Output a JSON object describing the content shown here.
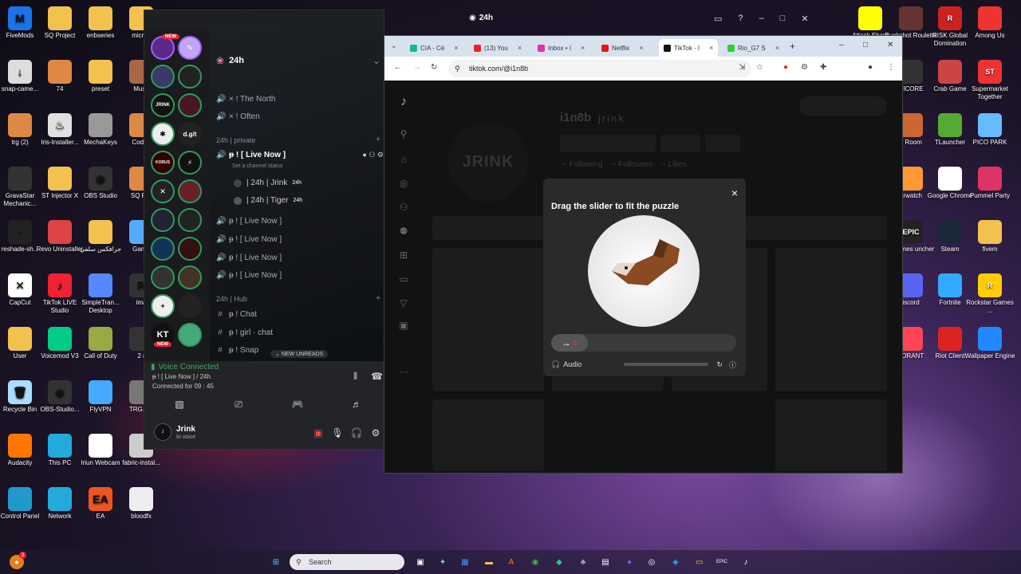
{
  "desktop_left": [
    {
      "label": "FiveMods",
      "glyph": "M",
      "color": "#1a73e8"
    },
    {
      "label": "SQ Project",
      "glyph": "",
      "color": "#f2c14e"
    },
    {
      "label": "enbseries",
      "glyph": "",
      "color": "#f2c14e"
    },
    {
      "label": "micros",
      "glyph": "",
      "color": "#f2c14e"
    },
    {
      "label": "snap-came...",
      "glyph": "↓",
      "color": "#ddd"
    },
    {
      "label": "74",
      "glyph": "",
      "color": "#d84"
    },
    {
      "label": "preset",
      "glyph": "",
      "color": "#f2c14e"
    },
    {
      "label": "Muse",
      "glyph": "",
      "color": "#a64"
    },
    {
      "label": "trg (2)",
      "glyph": "",
      "color": "#d84"
    },
    {
      "label": "Iris-Installer...",
      "glyph": "♨",
      "color": "#e0e0e0"
    },
    {
      "label": "MechaKeys",
      "glyph": "",
      "color": "#999"
    },
    {
      "label": "Codec",
      "glyph": "",
      "color": "#d84"
    },
    {
      "label": "GravaStar Mechanic...",
      "glyph": "",
      "color": "#333"
    },
    {
      "label": "ST Injector X",
      "glyph": "",
      "color": "#f2c14e"
    },
    {
      "label": "OBS Studio",
      "glyph": "◉",
      "color": "#333"
    },
    {
      "label": "SQ Pro",
      "glyph": "",
      "color": "#d84"
    },
    {
      "label": "reshade-sh...",
      "glyph": "·",
      "color": "#222"
    },
    {
      "label": "Revo Uninstaller",
      "glyph": "",
      "color": "#d44"
    },
    {
      "label": "جرافكس سلفي",
      "glyph": "",
      "color": "#f2c14e"
    },
    {
      "label": "Game",
      "glyph": "",
      "color": "#5af"
    },
    {
      "label": "CapCut",
      "glyph": "✕",
      "color": "#fff"
    },
    {
      "label": "TikTok LIVE Studio",
      "glyph": "♪",
      "color": "#e23"
    },
    {
      "label": "SimpleTran... Desktop",
      "glyph": "",
      "color": "#58f"
    },
    {
      "label": "ima",
      "glyph": "R",
      "color": "#333"
    },
    {
      "label": "User",
      "glyph": "",
      "color": "#f2c14e"
    },
    {
      "label": "Voicemod V3",
      "glyph": "",
      "color": "#0c8"
    },
    {
      "label": "Call of Duty",
      "glyph": "",
      "color": "#9a4"
    },
    {
      "label": "2 (",
      "glyph": "",
      "color": "#333"
    },
    {
      "label": "Recycle Bin",
      "glyph": "🗑",
      "color": "#adf"
    },
    {
      "label": "OBS-Studio...",
      "glyph": "◉",
      "color": "#333"
    },
    {
      "label": "FlyVPN",
      "glyph": "",
      "color": "#4af"
    },
    {
      "label": "TRG.SC",
      "glyph": "",
      "color": "#777"
    },
    {
      "label": "Audacity",
      "glyph": "",
      "color": "#f70"
    },
    {
      "label": "This PC",
      "glyph": "",
      "color": "#2ad"
    },
    {
      "label": "Iriun Webcam",
      "glyph": "",
      "color": "#fff"
    },
    {
      "label": "fabric-instal...",
      "glyph": "",
      "color": "#ccc"
    },
    {
      "label": "Control Panel",
      "glyph": "",
      "color": "#29c"
    },
    {
      "label": "Network",
      "glyph": "",
      "color": "#2ad"
    },
    {
      "label": "EA",
      "glyph": "EA",
      "color": "#e52"
    },
    {
      "label": "bloodfx",
      "glyph": "",
      "color": "#eee"
    }
  ],
  "desktop_right": [
    {
      "label": "Attack Shark",
      "glyph": "",
      "color": "#ff0"
    },
    {
      "label": "Buckshot Roulette",
      "glyph": "",
      "color": "#633"
    },
    {
      "label": "RISK Global Domination",
      "glyph": "R",
      "color": "#c22"
    },
    {
      "label": "Among Us",
      "glyph": "",
      "color": "#e33"
    },
    {
      "label": "NICORE",
      "glyph": "",
      "color": "#333"
    },
    {
      "label": "Crab Game",
      "glyph": "",
      "color": "#c44"
    },
    {
      "label": "Supermarket Together",
      "glyph": "ST",
      "color": "#e33"
    },
    {
      "label": "c Room",
      "glyph": "",
      "color": "#c63"
    },
    {
      "label": "TLauncher",
      "glyph": "",
      "color": "#5a3"
    },
    {
      "label": "PICO PARK",
      "glyph": "",
      "color": "#6bf"
    },
    {
      "label": "erwatch",
      "glyph": "",
      "color": "#f93"
    },
    {
      "label": "Google Chrome",
      "glyph": "",
      "color": "#fff"
    },
    {
      "label": "Pummel Party",
      "glyph": "",
      "color": "#d36"
    },
    {
      "label": "c Games uncher",
      "glyph": "EPIC",
      "color": "#222"
    },
    {
      "label": "Steam",
      "glyph": "",
      "color": "#1b2838"
    },
    {
      "label": "fivem",
      "glyph": "",
      "color": "#f2c14e"
    },
    {
      "label": "iscord",
      "glyph": "",
      "color": "#5865f2"
    },
    {
      "label": "Fortnite",
      "glyph": "",
      "color": "#3af"
    },
    {
      "label": "Rockstar Games ...",
      "glyph": "R",
      "color": "#fc0"
    },
    {
      "label": "LORANT",
      "glyph": "",
      "color": "#f45"
    },
    {
      "label": "Riot Client",
      "glyph": "",
      "color": "#d22"
    },
    {
      "label": "Wallpaper Engine",
      "glyph": "",
      "color": "#28f"
    }
  ],
  "discord": {
    "window_title": "24h",
    "server_name": "24h",
    "new_badge": "NEW",
    "new_badge_bottom": "NEW",
    "channels_top": [
      {
        "icon": "🔊",
        "label": "× ! The North"
      },
      {
        "icon": "🔊",
        "label": "× ! Often"
      }
    ],
    "category_private": "24h | private",
    "live_channel": "ᵽ ! [ Live Now ]",
    "channel_status_placeholder": "Set a channel status",
    "voice_members": [
      {
        "name": "| 24h | Jrink",
        "tag": "24h"
      },
      {
        "name": "| 24h | Tiger",
        "tag": "24h"
      }
    ],
    "live_repeats": [
      "ᵽ ! [ Live Now ]",
      "ᵽ ! [ Live Now ]",
      "ᵽ ! [ Live Now ]",
      "ᵽ ! [ Live Now ]"
    ],
    "category_hub": "24h | Hub",
    "text_channels": [
      "ᵽ ! Chat",
      "ᵽ ! girl · chat",
      "ᵽ ! Snap"
    ],
    "new_unreads": "NEW UNREADS",
    "voice_connected": "Voice Connected",
    "voice_location": "ᵽ ! [ Live Now ] / 24h",
    "connected_for": "Connected for 09 : 45",
    "user_name": "Jrink",
    "user_status": "In voice",
    "server_labels": [
      "",
      "JRINK",
      "KT",
      "d.g/t",
      "KORUS"
    ]
  },
  "chrome": {
    "tabs": [
      {
        "label": "CIA - Cé",
        "color": "#1b8"
      },
      {
        "label": "(13) You",
        "color": "#e22"
      },
      {
        "label": "Inbox • I",
        "color": "#d3a"
      },
      {
        "label": "Netflix",
        "color": "#e11"
      },
      {
        "label": "TikTok - I",
        "color": "#111"
      },
      {
        "label": "Rio_G7 S",
        "color": "#3c3"
      }
    ],
    "new_tab": "+",
    "url": "tiktok.com/@i1n8b",
    "profile_name": "i1n8b",
    "profile_handle": "jrink",
    "avatar_text": "JRINK",
    "stats": {
      "following": "Following",
      "followers": "Followers",
      "likes": "Likes",
      "placeholder": "--"
    }
  },
  "captcha": {
    "title": "Drag the slider to fit the puzzle",
    "audio_label": "Audio",
    "close": "×",
    "knob_arrow": "→"
  },
  "taskbar": {
    "search_placeholder": "Search",
    "notification_count": "3"
  }
}
